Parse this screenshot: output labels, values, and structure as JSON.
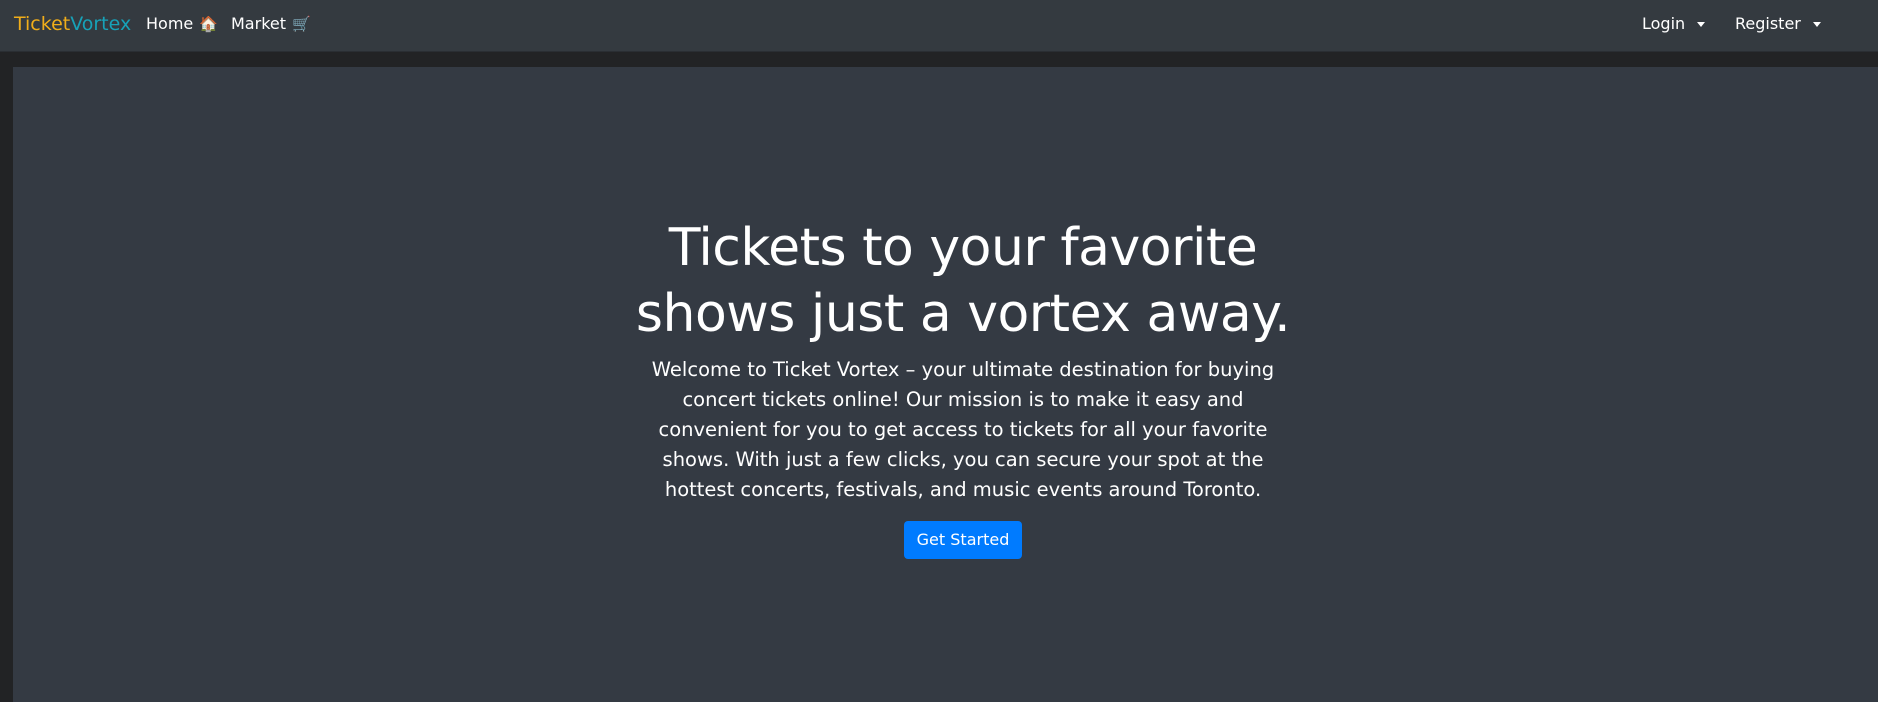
{
  "navbar": {
    "brand": {
      "part1": "Ticket",
      "part2": "Vortex",
      "color1": "#f0ad1a",
      "color2": "#17a2b8"
    },
    "home": {
      "label": "Home",
      "icon": "🏠"
    },
    "market": {
      "label": "Market",
      "icon": "🛒"
    },
    "login": {
      "label": "Login"
    },
    "register": {
      "label": "Register"
    }
  },
  "hero": {
    "title": "Tickets to your favorite shows just a vortex away.",
    "text": "Welcome to Ticket Vortex – your ultimate destination for buying concert tickets online! Our mission is to make it easy and convenient for you to get access to tickets for all your favorite shows. With just a few clicks, you can secure your spot at the hottest concerts, festivals, and music events around Toronto.",
    "cta_label": "Get Started",
    "cta_color": "#007bff"
  },
  "colors": {
    "navbar_bg": "#343a40",
    "hero_bg": "#343a43",
    "page_bg": "#222325"
  }
}
